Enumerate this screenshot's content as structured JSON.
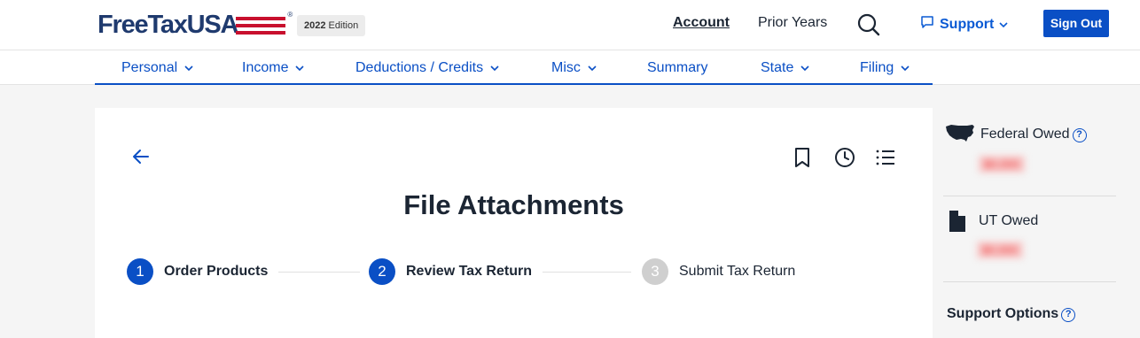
{
  "brand": {
    "logo_text": "FreeTaxUSA",
    "reg_mark": "®",
    "edition_year": "2022",
    "edition_label": "Edition"
  },
  "header": {
    "account_label": "Account",
    "prior_years_label": "Prior Years",
    "support_label": "Support",
    "sign_out_label": "Sign Out",
    "accent_color": "#0a4fc5"
  },
  "nav": {
    "items": [
      {
        "label": "Personal",
        "dropdown": true
      },
      {
        "label": "Income",
        "dropdown": true
      },
      {
        "label": "Deductions / Credits",
        "dropdown": true
      },
      {
        "label": "Misc",
        "dropdown": true
      },
      {
        "label": "Summary",
        "dropdown": false
      },
      {
        "label": "State",
        "dropdown": true
      },
      {
        "label": "Filing",
        "dropdown": true
      }
    ]
  },
  "page": {
    "title": "File Attachments",
    "steps": [
      {
        "number": "1",
        "label": "Order Products",
        "active": true
      },
      {
        "number": "2",
        "label": "Review Tax Return",
        "active": true
      },
      {
        "number": "3",
        "label": "Submit Tax Return",
        "active": false
      }
    ]
  },
  "sidebar": {
    "federal_label": "Federal Owed",
    "federal_value": "$0,000",
    "state_label": "UT Owed",
    "state_value": "$0,000",
    "support_options_label": "Support Options",
    "help_glyph": "?"
  }
}
